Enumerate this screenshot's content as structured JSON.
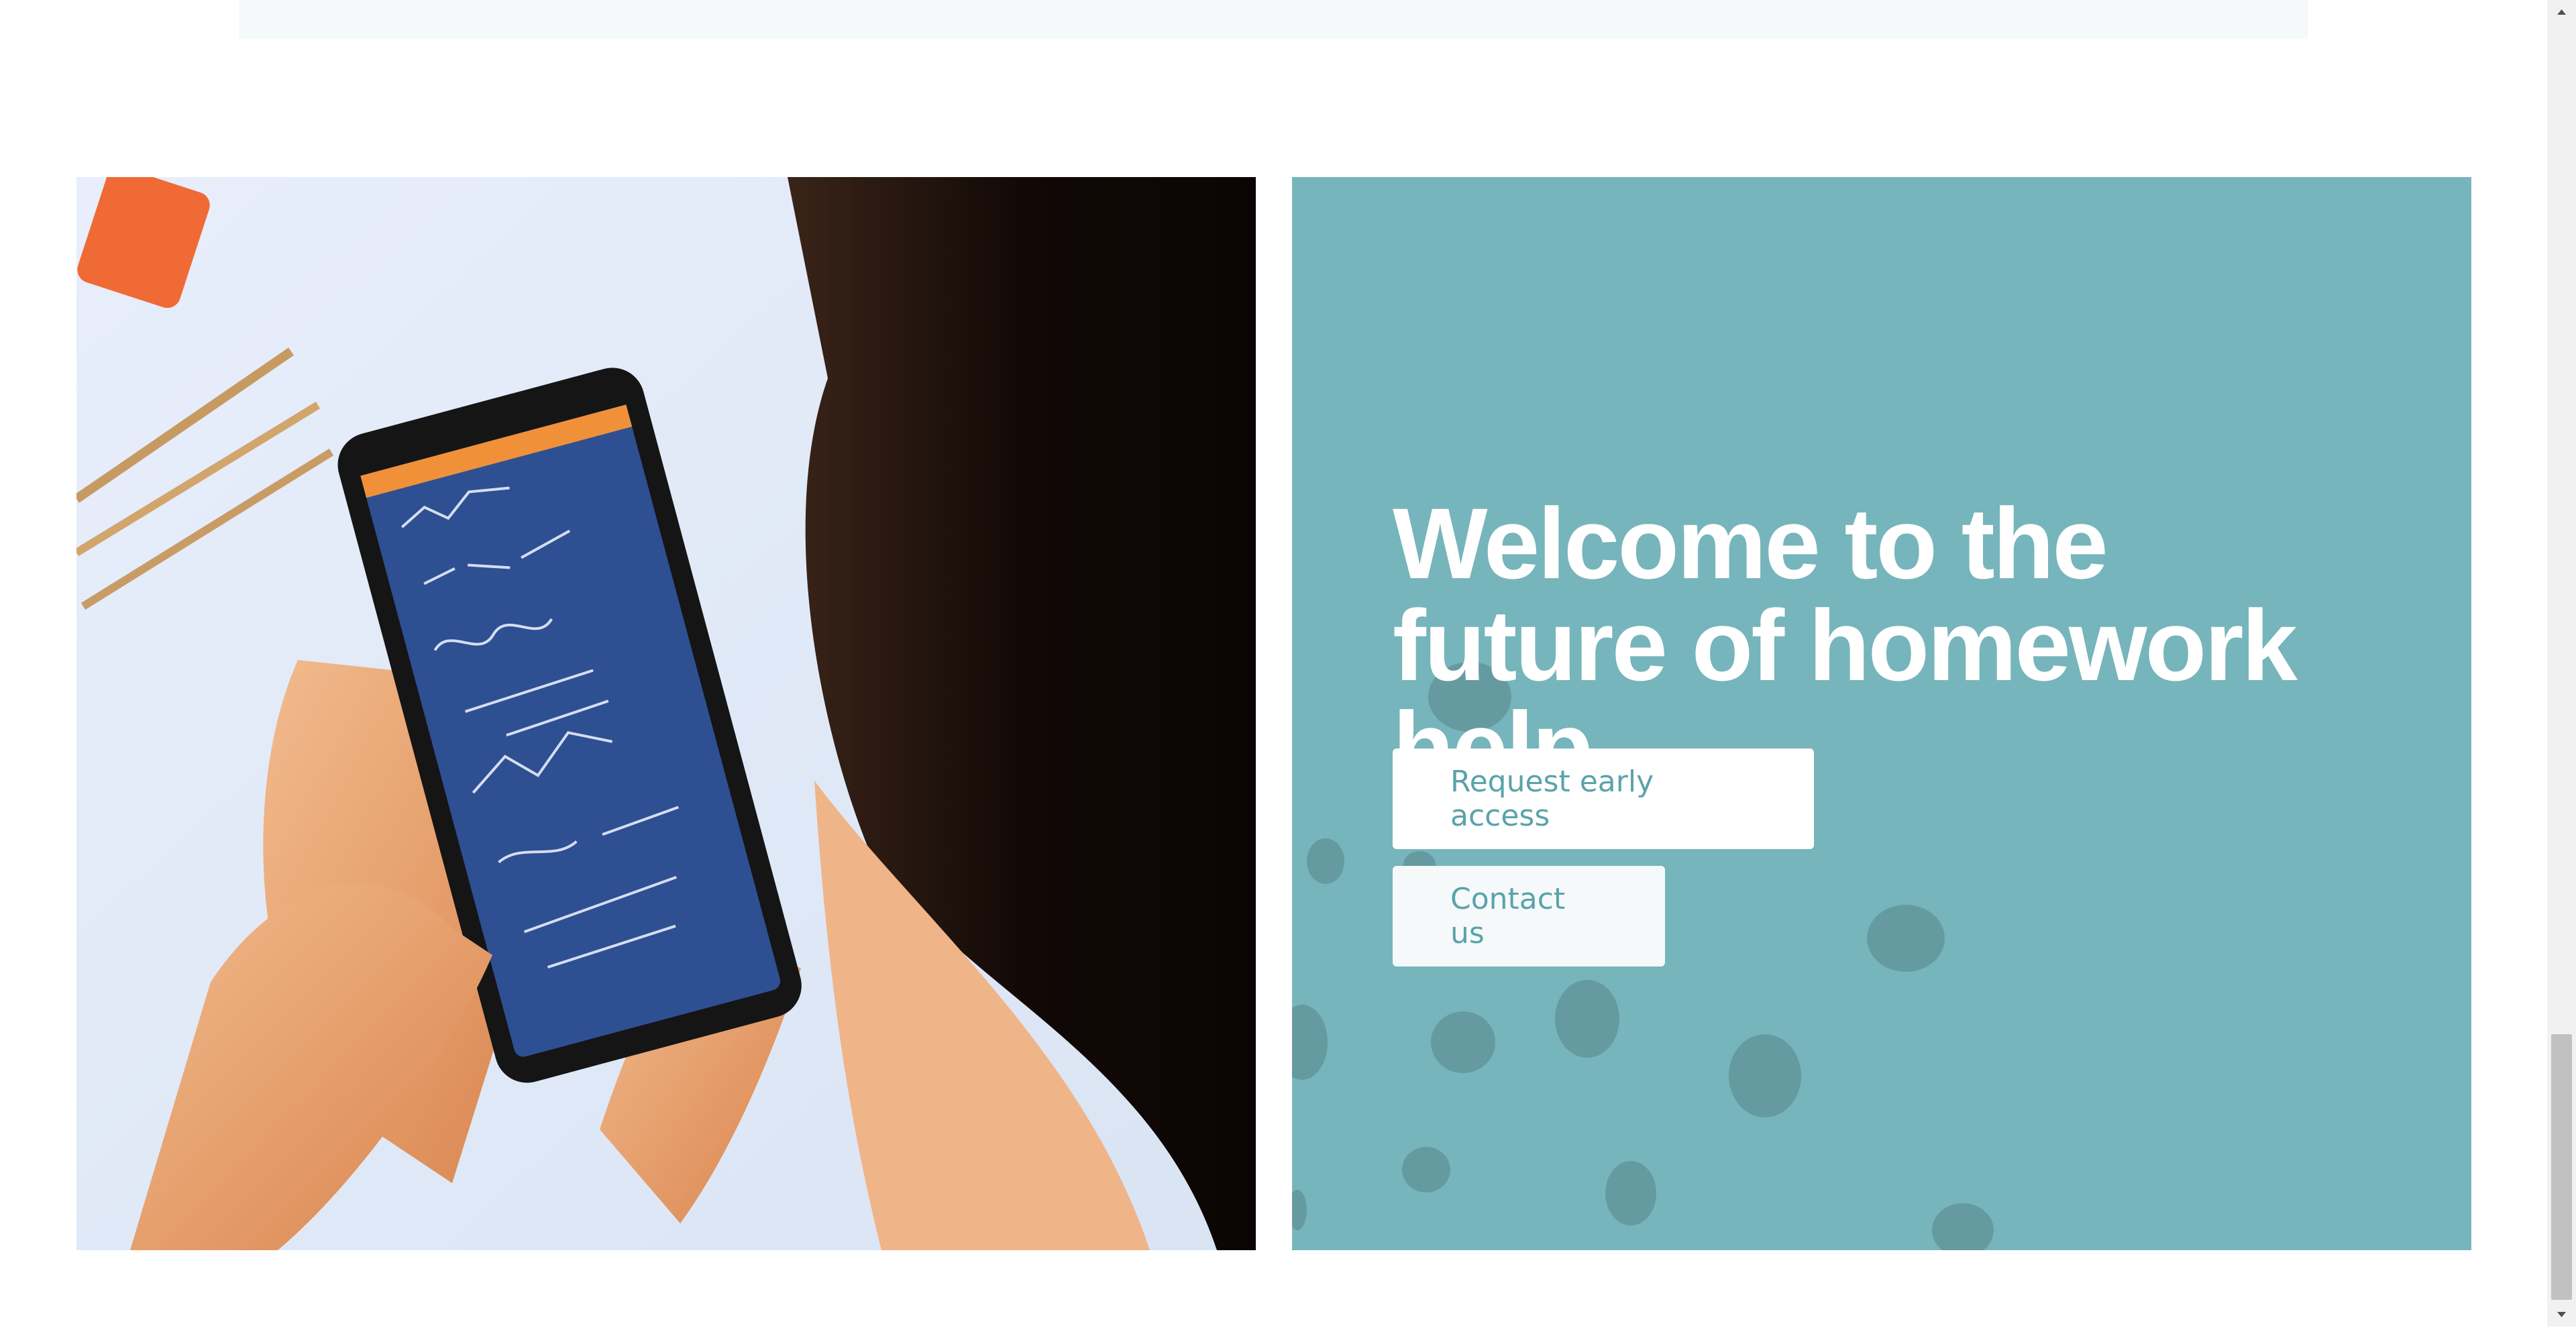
{
  "hero": {
    "title": "Welcome to the future of homework help.",
    "image_alt": "Person holding a smartphone displaying handwritten math notes",
    "panel_color": "#76b5bb"
  },
  "actions": {
    "request_access_label": "Request early access",
    "contact_label": "Contact us"
  },
  "icons": {
    "scroll_up": "chevron-up-icon",
    "scroll_down": "chevron-down-icon"
  }
}
